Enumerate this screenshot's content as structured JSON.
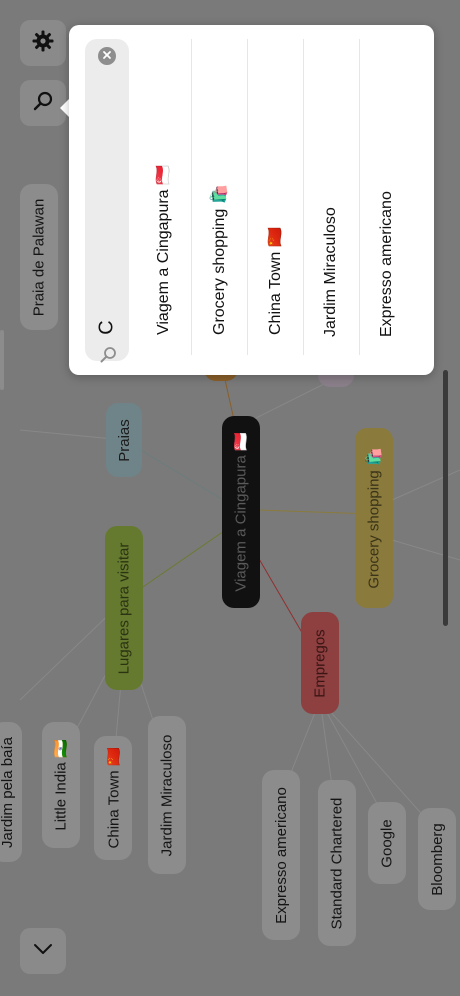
{
  "mindmap": {
    "root": "Viagem a Cingapura 🇸🇬",
    "branches": {
      "praias": "Praias",
      "lugares": "Lugares para visitar",
      "empregos": "Empregos",
      "grocery": "Grocery shopping 🛍️"
    },
    "leaves": {
      "praia_palawan": "Praia de Palawan",
      "jardim_baia": "Jardim pela baía",
      "little_india": "Little India 🇮🇳",
      "china_town": "China Town 🇨🇳",
      "jardim_miraculoso": "Jardim Miraculoso",
      "expresso": "Expresso americano",
      "standard": "Standard Chartered",
      "google": "Google",
      "bloomberg": "Bloomberg"
    },
    "colors": {
      "root": "#111111",
      "praias": "#6f8488",
      "lugares": "#667a2f",
      "empregos": "#8e3f3f",
      "grocery": "#8a7a3c"
    }
  },
  "toolbar": {
    "settings_icon": "gear-icon",
    "search_icon": "search-icon",
    "collapse_icon": "chevron-down-icon"
  },
  "search": {
    "query": "C",
    "results": [
      "Viagem a Cingapura 🇸🇬",
      "Grocery shopping 🛍️",
      "China Town 🇨🇳",
      "Jardim Miraculoso",
      "Expresso americano"
    ]
  }
}
